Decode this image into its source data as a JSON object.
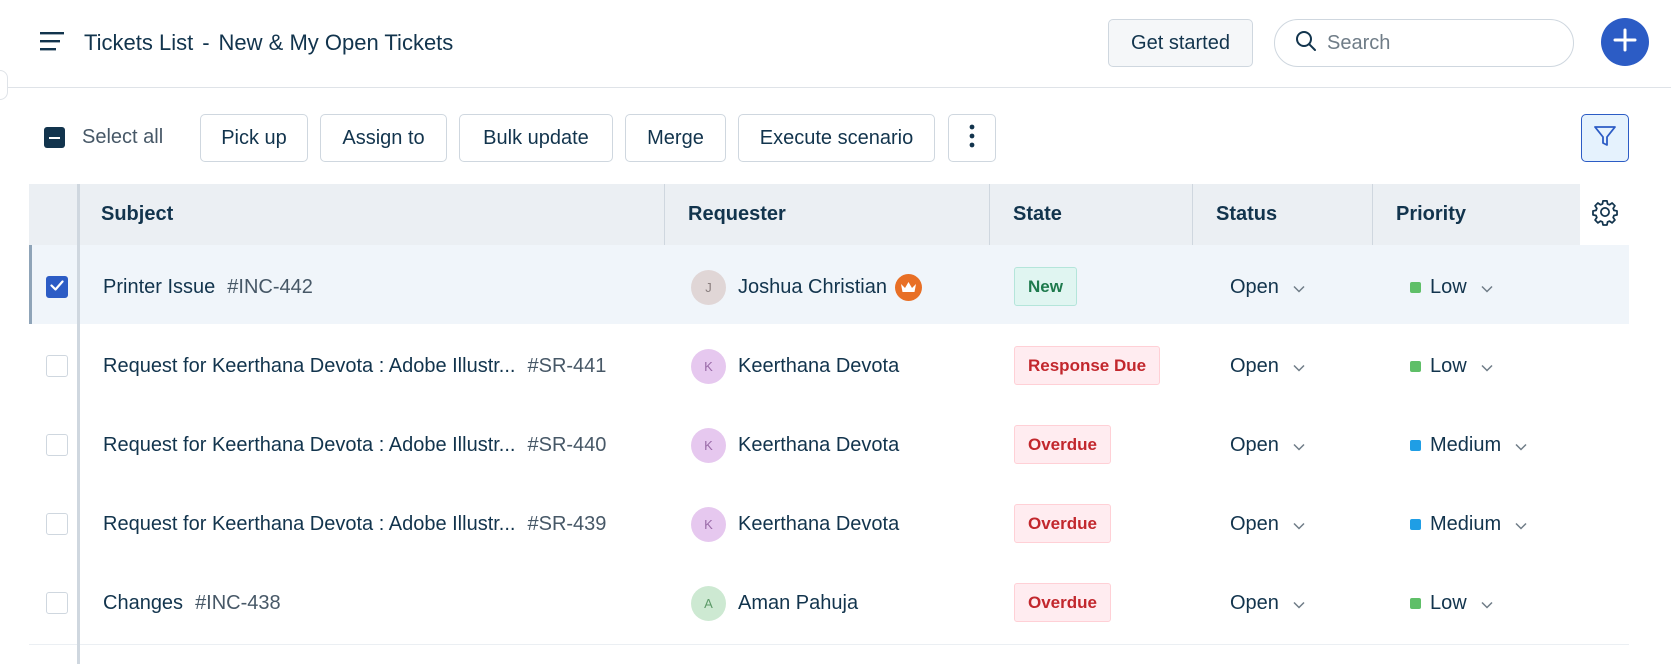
{
  "header": {
    "title": "Tickets List",
    "separator": "-",
    "view_name": "New & My Open Tickets",
    "get_started_label": "Get started",
    "search_placeholder": "Search",
    "icons": {
      "menu": "hamburger-menu-icon",
      "search": "search-icon",
      "add": "plus-icon"
    },
    "accent_color": "#2c5cc5"
  },
  "toolbar": {
    "select_all_label": "Select all",
    "buttons": [
      {
        "label": "Pick up"
      },
      {
        "label": "Assign to"
      },
      {
        "label": "Bulk update"
      },
      {
        "label": "Merge"
      },
      {
        "label": "Execute scenario"
      }
    ],
    "icons": {
      "more": "vertical-ellipsis-icon",
      "filter": "funnel-filter-icon"
    }
  },
  "table": {
    "columns": [
      "Subject",
      "Requester",
      "State",
      "Status",
      "Priority"
    ],
    "settings_icon": "gear-icon",
    "rows": [
      {
        "selected": true,
        "subject": "Printer Issue",
        "id": "#INC-442",
        "requester_initial": "J",
        "requester": "Joshua Christian",
        "vip": true,
        "avatar_bg": "#e0d6d6",
        "avatar_fg": "#8a7f7f",
        "state": "New",
        "state_type": "new",
        "status": "Open",
        "priority": "Low",
        "priority_color": "#5fbf68"
      },
      {
        "selected": false,
        "subject": "Request for Keerthana Devota : Adobe Illustr...",
        "id": "#SR-441",
        "requester_initial": "K",
        "requester": "Keerthana Devota",
        "vip": false,
        "avatar_bg": "#e6c8ef",
        "avatar_fg": "#9a6aa8",
        "state": "Response Due",
        "state_type": "due",
        "status": "Open",
        "priority": "Low",
        "priority_color": "#5fbf68"
      },
      {
        "selected": false,
        "subject": "Request for Keerthana Devota : Adobe Illustr...",
        "id": "#SR-440",
        "requester_initial": "K",
        "requester": "Keerthana Devota",
        "vip": false,
        "avatar_bg": "#e6c8ef",
        "avatar_fg": "#9a6aa8",
        "state": "Overdue",
        "state_type": "due",
        "status": "Open",
        "priority": "Medium",
        "priority_color": "#1f9ee5"
      },
      {
        "selected": false,
        "subject": "Request for Keerthana Devota : Adobe Illustr...",
        "id": "#SR-439",
        "requester_initial": "K",
        "requester": "Keerthana Devota",
        "vip": false,
        "avatar_bg": "#e6c8ef",
        "avatar_fg": "#9a6aa8",
        "state": "Overdue",
        "state_type": "due",
        "status": "Open",
        "priority": "Medium",
        "priority_color": "#1f9ee5"
      },
      {
        "selected": false,
        "subject": "Changes",
        "id": "#INC-438",
        "requester_initial": "A",
        "requester": "Aman Pahuja",
        "vip": false,
        "avatar_bg": "#cde9d2",
        "avatar_fg": "#5c9a68",
        "state": "Overdue",
        "state_type": "due",
        "status": "Open",
        "priority": "Low",
        "priority_color": "#5fbf68"
      }
    ]
  }
}
